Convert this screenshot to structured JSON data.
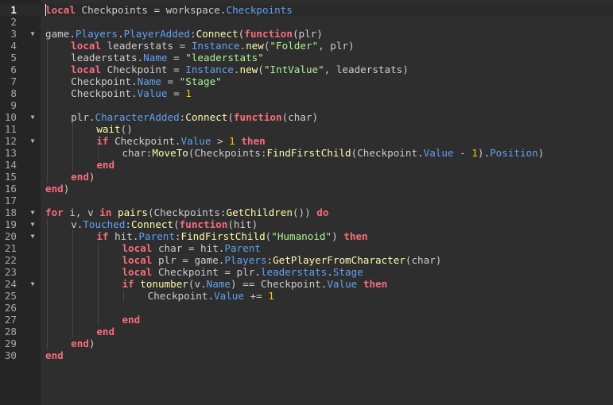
{
  "editor": {
    "language": "lua",
    "current_line": 1,
    "fold_icon": "fold-triangle-icon",
    "colors": {
      "background": "#2e2e2e",
      "gutter": "#252525",
      "keyword": "#f86d7c",
      "property": "#61a1f1",
      "method": "#fdfbac",
      "string": "#adf195",
      "number": "#ffc600",
      "text": "#cccccc"
    },
    "lines": [
      {
        "n": "1",
        "fold": false,
        "indent": 0,
        "tokens": [
          {
            "t": "k",
            "v": "local"
          },
          {
            "t": "i",
            "v": " Checkpoints = workspace."
          },
          {
            "t": "p",
            "v": "Checkpoints"
          }
        ]
      },
      {
        "n": "2",
        "fold": false,
        "indent": 0,
        "tokens": []
      },
      {
        "n": "3",
        "fold": true,
        "indent": 0,
        "tokens": [
          {
            "t": "i",
            "v": "game."
          },
          {
            "t": "p",
            "v": "Players"
          },
          {
            "t": "i",
            "v": "."
          },
          {
            "t": "p",
            "v": "PlayerAdded"
          },
          {
            "t": "i",
            "v": ":"
          },
          {
            "t": "f",
            "v": "Connect"
          },
          {
            "t": "i",
            "v": "("
          },
          {
            "t": "k",
            "v": "function"
          },
          {
            "t": "i",
            "v": "(plr)"
          }
        ]
      },
      {
        "n": "4",
        "fold": false,
        "indent": 1,
        "tokens": [
          {
            "t": "k",
            "v": "local"
          },
          {
            "t": "i",
            "v": " leaderstats = "
          },
          {
            "t": "p",
            "v": "Instance"
          },
          {
            "t": "i",
            "v": "."
          },
          {
            "t": "f",
            "v": "new"
          },
          {
            "t": "i",
            "v": "("
          },
          {
            "t": "s",
            "v": "\"Folder\""
          },
          {
            "t": "i",
            "v": ", plr)"
          }
        ]
      },
      {
        "n": "5",
        "fold": false,
        "indent": 1,
        "tokens": [
          {
            "t": "i",
            "v": "leaderstats."
          },
          {
            "t": "p",
            "v": "Name"
          },
          {
            "t": "i",
            "v": " = "
          },
          {
            "t": "s",
            "v": "\"leaderstats\""
          }
        ]
      },
      {
        "n": "6",
        "fold": false,
        "indent": 1,
        "tokens": [
          {
            "t": "k",
            "v": "local"
          },
          {
            "t": "i",
            "v": " Checkpoint = "
          },
          {
            "t": "p",
            "v": "Instance"
          },
          {
            "t": "i",
            "v": "."
          },
          {
            "t": "f",
            "v": "new"
          },
          {
            "t": "i",
            "v": "("
          },
          {
            "t": "s",
            "v": "\"IntValue\""
          },
          {
            "t": "i",
            "v": ", leaderstats)"
          }
        ]
      },
      {
        "n": "7",
        "fold": false,
        "indent": 1,
        "tokens": [
          {
            "t": "i",
            "v": "Checkpoint."
          },
          {
            "t": "p",
            "v": "Name"
          },
          {
            "t": "i",
            "v": " = "
          },
          {
            "t": "s",
            "v": "\"Stage\""
          }
        ]
      },
      {
        "n": "8",
        "fold": false,
        "indent": 1,
        "tokens": [
          {
            "t": "i",
            "v": "Checkpoint."
          },
          {
            "t": "p",
            "v": "Value"
          },
          {
            "t": "i",
            "v": " = "
          },
          {
            "t": "n",
            "v": "1"
          }
        ]
      },
      {
        "n": "9",
        "fold": false,
        "indent": 0,
        "tokens": []
      },
      {
        "n": "10",
        "fold": true,
        "indent": 1,
        "tokens": [
          {
            "t": "i",
            "v": "plr."
          },
          {
            "t": "p",
            "v": "CharacterAdded"
          },
          {
            "t": "i",
            "v": ":"
          },
          {
            "t": "f",
            "v": "Connect"
          },
          {
            "t": "i",
            "v": "("
          },
          {
            "t": "k",
            "v": "function"
          },
          {
            "t": "i",
            "v": "(char)"
          }
        ]
      },
      {
        "n": "11",
        "fold": false,
        "indent": 2,
        "tokens": [
          {
            "t": "f",
            "v": "wait"
          },
          {
            "t": "i",
            "v": "()"
          }
        ]
      },
      {
        "n": "12",
        "fold": true,
        "indent": 2,
        "tokens": [
          {
            "t": "k",
            "v": "if"
          },
          {
            "t": "i",
            "v": " Checkpoint."
          },
          {
            "t": "p",
            "v": "Value"
          },
          {
            "t": "i",
            "v": " > "
          },
          {
            "t": "n",
            "v": "1"
          },
          {
            "t": "i",
            "v": " "
          },
          {
            "t": "k",
            "v": "then"
          }
        ]
      },
      {
        "n": "13",
        "fold": false,
        "indent": 3,
        "tokens": [
          {
            "t": "i",
            "v": "char:"
          },
          {
            "t": "f",
            "v": "MoveTo"
          },
          {
            "t": "i",
            "v": "(Checkpoints:"
          },
          {
            "t": "f",
            "v": "FindFirstChild"
          },
          {
            "t": "i",
            "v": "(Checkpoint."
          },
          {
            "t": "p",
            "v": "Value"
          },
          {
            "t": "i",
            "v": " - "
          },
          {
            "t": "n",
            "v": "1"
          },
          {
            "t": "i",
            "v": ")."
          },
          {
            "t": "p",
            "v": "Position"
          },
          {
            "t": "i",
            "v": ")"
          }
        ]
      },
      {
        "n": "14",
        "fold": false,
        "indent": 2,
        "tokens": [
          {
            "t": "k",
            "v": "end"
          }
        ]
      },
      {
        "n": "15",
        "fold": false,
        "indent": 1,
        "tokens": [
          {
            "t": "k",
            "v": "end"
          },
          {
            "t": "i",
            "v": ")"
          }
        ]
      },
      {
        "n": "16",
        "fold": false,
        "indent": 0,
        "tokens": [
          {
            "t": "k",
            "v": "end"
          },
          {
            "t": "i",
            "v": ")"
          }
        ]
      },
      {
        "n": "17",
        "fold": false,
        "indent": 0,
        "tokens": []
      },
      {
        "n": "18",
        "fold": true,
        "indent": 0,
        "tokens": [
          {
            "t": "k",
            "v": "for"
          },
          {
            "t": "i",
            "v": " i, v "
          },
          {
            "t": "k",
            "v": "in"
          },
          {
            "t": "i",
            "v": " "
          },
          {
            "t": "f",
            "v": "pairs"
          },
          {
            "t": "i",
            "v": "(Checkpoints:"
          },
          {
            "t": "f",
            "v": "GetChildren"
          },
          {
            "t": "i",
            "v": "()) "
          },
          {
            "t": "k",
            "v": "do"
          }
        ]
      },
      {
        "n": "19",
        "fold": true,
        "indent": 1,
        "tokens": [
          {
            "t": "i",
            "v": "v."
          },
          {
            "t": "p",
            "v": "Touched"
          },
          {
            "t": "i",
            "v": ":"
          },
          {
            "t": "f",
            "v": "Connect"
          },
          {
            "t": "i",
            "v": "("
          },
          {
            "t": "k",
            "v": "function"
          },
          {
            "t": "i",
            "v": "(hit)"
          }
        ]
      },
      {
        "n": "20",
        "fold": true,
        "indent": 2,
        "tokens": [
          {
            "t": "k",
            "v": "if"
          },
          {
            "t": "i",
            "v": " hit."
          },
          {
            "t": "p",
            "v": "Parent"
          },
          {
            "t": "i",
            "v": ":"
          },
          {
            "t": "f",
            "v": "FindFirstChild"
          },
          {
            "t": "i",
            "v": "("
          },
          {
            "t": "s",
            "v": "\"Humanoid\""
          },
          {
            "t": "i",
            "v": ") "
          },
          {
            "t": "k",
            "v": "then"
          }
        ]
      },
      {
        "n": "21",
        "fold": false,
        "indent": 3,
        "tokens": [
          {
            "t": "k",
            "v": "local"
          },
          {
            "t": "i",
            "v": " char = hit."
          },
          {
            "t": "p",
            "v": "Parent"
          }
        ]
      },
      {
        "n": "22",
        "fold": false,
        "indent": 3,
        "tokens": [
          {
            "t": "k",
            "v": "local"
          },
          {
            "t": "i",
            "v": " plr = game."
          },
          {
            "t": "p",
            "v": "Players"
          },
          {
            "t": "i",
            "v": ":"
          },
          {
            "t": "f",
            "v": "GetPlayerFromCharacter"
          },
          {
            "t": "i",
            "v": "(char)"
          }
        ]
      },
      {
        "n": "23",
        "fold": false,
        "indent": 3,
        "tokens": [
          {
            "t": "k",
            "v": "local"
          },
          {
            "t": "i",
            "v": " Checkpoint = plr."
          },
          {
            "t": "p",
            "v": "leaderstats"
          },
          {
            "t": "i",
            "v": "."
          },
          {
            "t": "p",
            "v": "Stage"
          }
        ]
      },
      {
        "n": "24",
        "fold": true,
        "indent": 3,
        "tokens": [
          {
            "t": "k",
            "v": "if"
          },
          {
            "t": "i",
            "v": " "
          },
          {
            "t": "f",
            "v": "tonumber"
          },
          {
            "t": "i",
            "v": "(v."
          },
          {
            "t": "p",
            "v": "Name"
          },
          {
            "t": "i",
            "v": ") == Checkpoint."
          },
          {
            "t": "p",
            "v": "Value"
          },
          {
            "t": "i",
            "v": " "
          },
          {
            "t": "k",
            "v": "then"
          }
        ]
      },
      {
        "n": "25",
        "fold": false,
        "indent": 4,
        "tokens": [
          {
            "t": "i",
            "v": "Checkpoint."
          },
          {
            "t": "p",
            "v": "Value"
          },
          {
            "t": "i",
            "v": " += "
          },
          {
            "t": "n",
            "v": "1"
          }
        ]
      },
      {
        "n": "26",
        "fold": false,
        "indent": 0,
        "tokens": []
      },
      {
        "n": "27",
        "fold": false,
        "indent": 3,
        "tokens": [
          {
            "t": "k",
            "v": "end"
          }
        ]
      },
      {
        "n": "28",
        "fold": false,
        "indent": 2,
        "tokens": [
          {
            "t": "k",
            "v": "end"
          }
        ]
      },
      {
        "n": "29",
        "fold": false,
        "indent": 1,
        "tokens": [
          {
            "t": "k",
            "v": "end"
          },
          {
            "t": "i",
            "v": ")"
          }
        ]
      },
      {
        "n": "30",
        "fold": false,
        "indent": 0,
        "tokens": [
          {
            "t": "k",
            "v": "end"
          }
        ]
      }
    ]
  }
}
